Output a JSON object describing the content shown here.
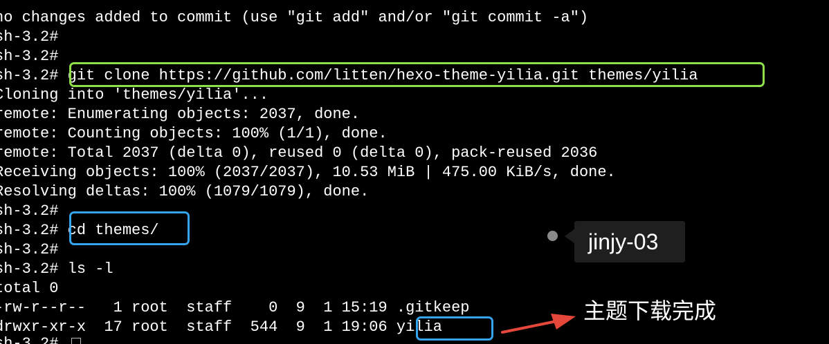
{
  "terminal": {
    "lines": [
      "no changes added to commit (use \"git add\" and/or \"git commit -a\")",
      "sh-3.2#",
      "sh-3.2#",
      "sh-3.2# git clone https://github.com/litten/hexo-theme-yilia.git themes/yilia",
      "Cloning into 'themes/yilia'...",
      "remote: Enumerating objects: 2037, done.",
      "remote: Counting objects: 100% (1/1), done.",
      "remote: Total 2037 (delta 0), reused 0 (delta 0), pack-reused 2036",
      "Receiving objects: 100% (2037/2037), 10.53 MiB | 475.00 KiB/s, done.",
      "Resolving deltas: 100% (1079/1079), done.",
      "sh-3.2#",
      "sh-3.2# cd themes/",
      "sh-3.2#",
      "sh-3.2# ls -l",
      "total 0",
      "-rw-r--r--   1 root  staff    0  9  1 15:19 .gitkeep",
      "drwxr-xr-x  17 root  staff  544  9  1 19:06 yilia",
      "sh-3.2# "
    ]
  },
  "tooltip": {
    "label": "jinjy-03"
  },
  "annotation": {
    "text": "主题下载完成",
    "arrow_color": "#e5473a"
  },
  "colors": {
    "background": "#000000",
    "text": "#ffffff",
    "highlight_green": "#8ee04a",
    "highlight_blue": "#35a4ee"
  }
}
